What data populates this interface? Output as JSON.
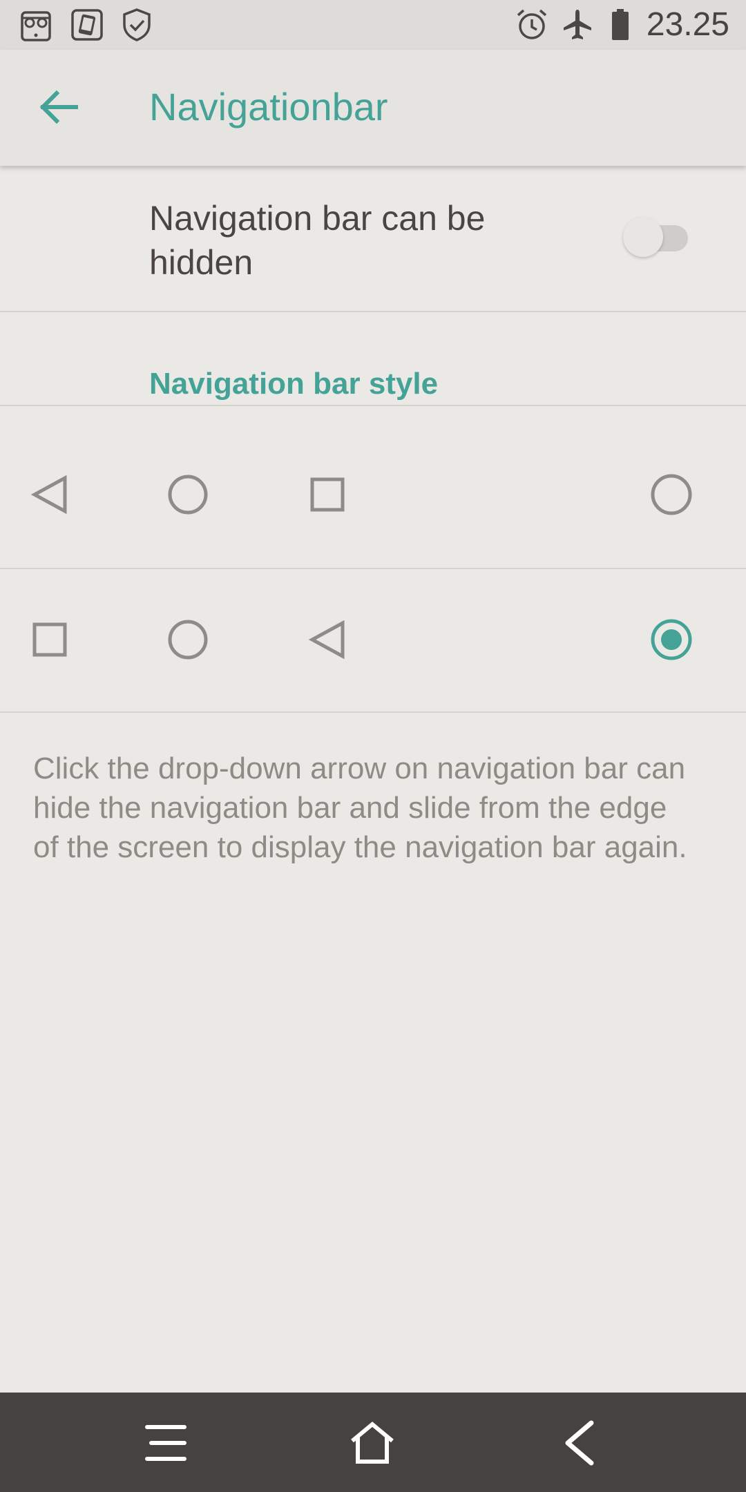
{
  "status_bar": {
    "time": "23.25",
    "left_icons": [
      "glasses-app-icon",
      "tablet-app-icon",
      "shield-check-icon"
    ],
    "right_icons": [
      "alarm-icon",
      "airplane-mode-icon",
      "battery-icon"
    ]
  },
  "app_bar": {
    "title": "Navigationbar",
    "back_icon": "arrow-left-icon"
  },
  "settings": {
    "hide_toggle": {
      "label": "Navigation bar can be hidden",
      "checked": false
    },
    "style_section": {
      "header": "Navigation bar style",
      "options": [
        {
          "layout": [
            "back-triangle-icon",
            "home-circle-icon",
            "recents-square-icon"
          ],
          "selected": false
        },
        {
          "layout": [
            "recents-square-icon",
            "home-circle-icon",
            "back-triangle-icon"
          ],
          "selected": true
        }
      ]
    },
    "description": "Click the drop-down arrow on navigation bar can hide the navigation bar and slide from the edge of the screen to display the navigation bar again."
  },
  "system_nav": {
    "buttons": [
      "menu-icon",
      "home-icon",
      "back-icon"
    ]
  },
  "colors": {
    "accent": "#44a396",
    "background": "#ebe9e5",
    "app_bar": "#e6e4e0",
    "status_bar": "#dedbd8",
    "system_nav": "#45423f",
    "icon_gray": "#8f8b88"
  }
}
